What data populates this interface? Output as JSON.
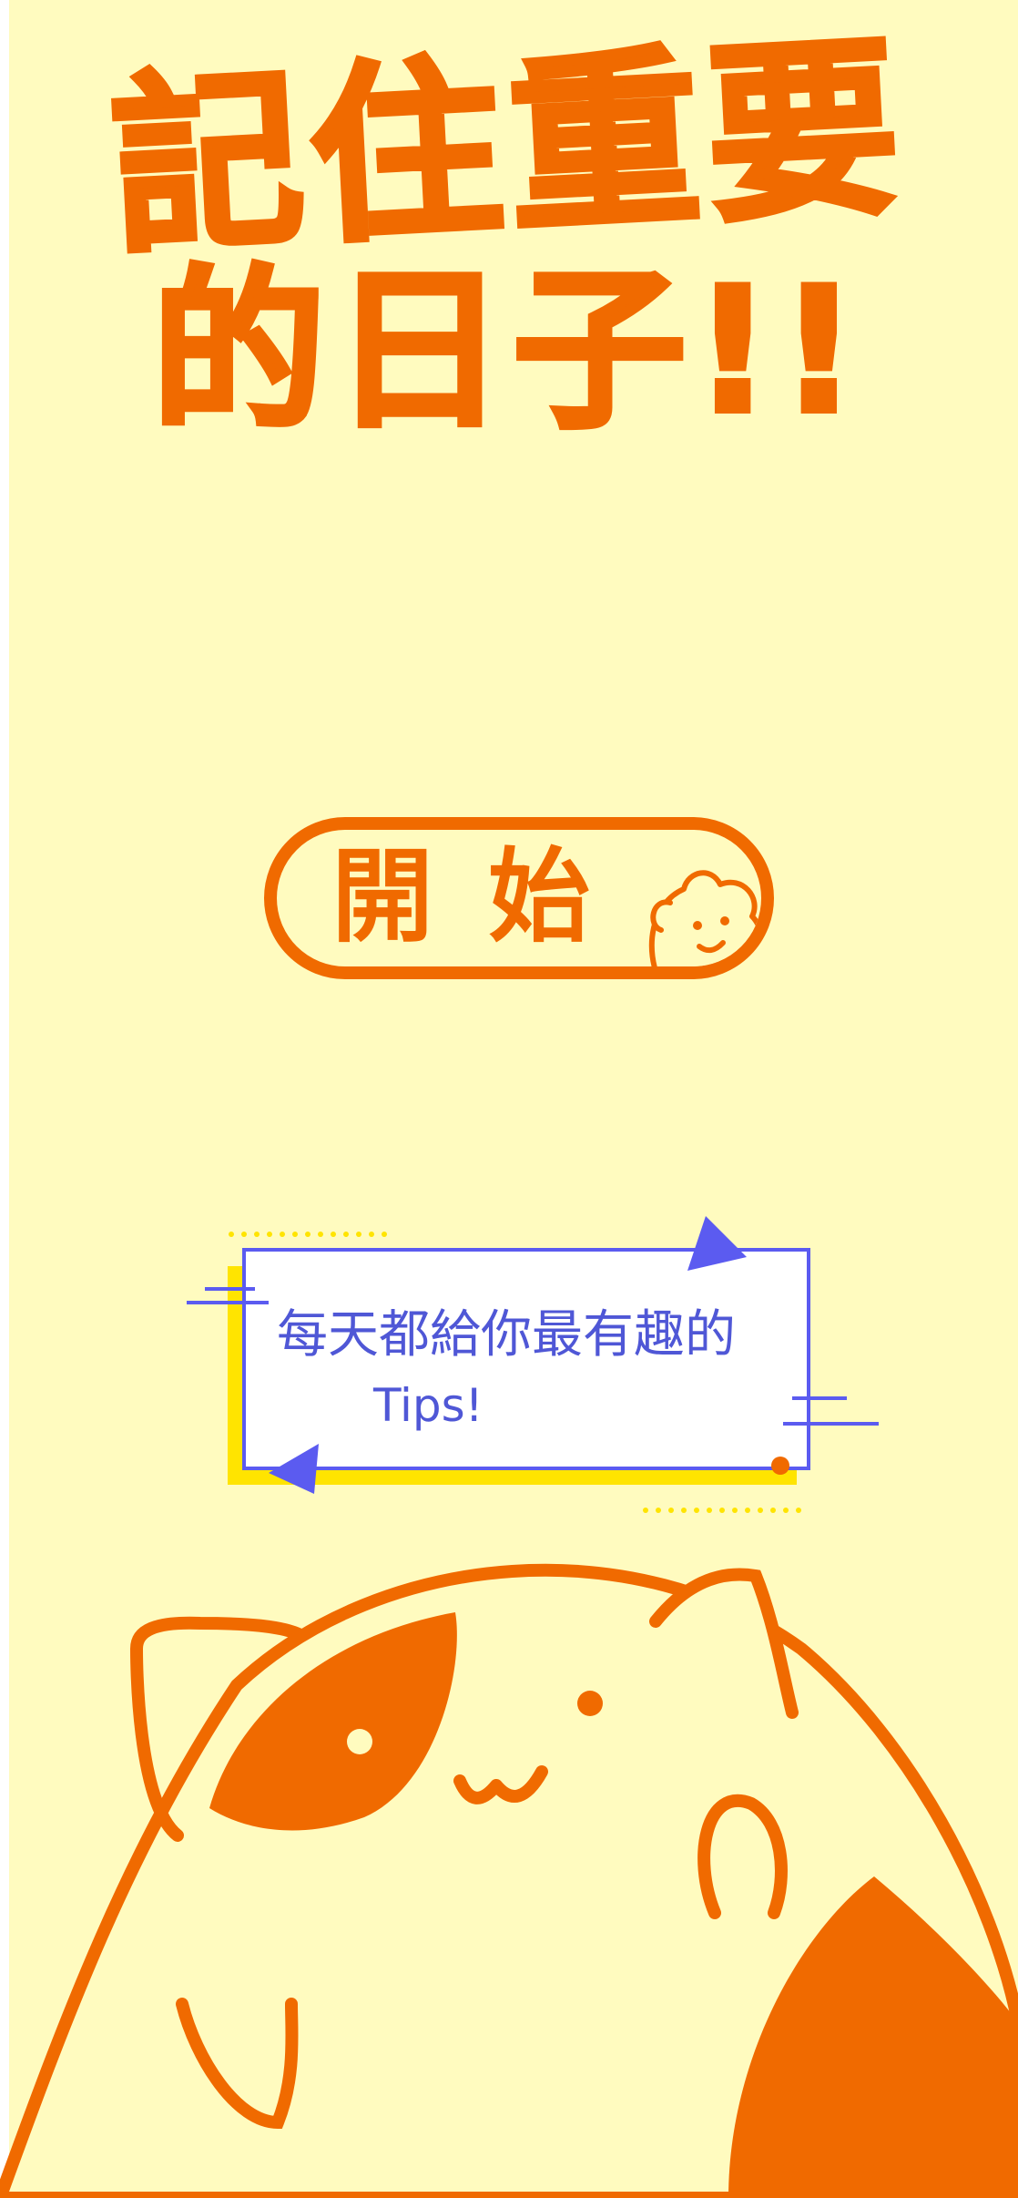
{
  "title": {
    "line1": "記住重要",
    "line2": "的日子!!"
  },
  "start_button": {
    "label": "開始"
  },
  "tips": {
    "line1": "每天都給你最有趣的",
    "line2": "Tips!"
  },
  "colors": {
    "background": "#FFFBBF",
    "accent_orange": "#F06A00",
    "accent_blue": "#5B5BF0",
    "accent_yellow": "#FFE400"
  },
  "icons": {
    "bear": "bear-face-icon",
    "triangle": "triangle-icon",
    "cat": "cat-illustration"
  }
}
